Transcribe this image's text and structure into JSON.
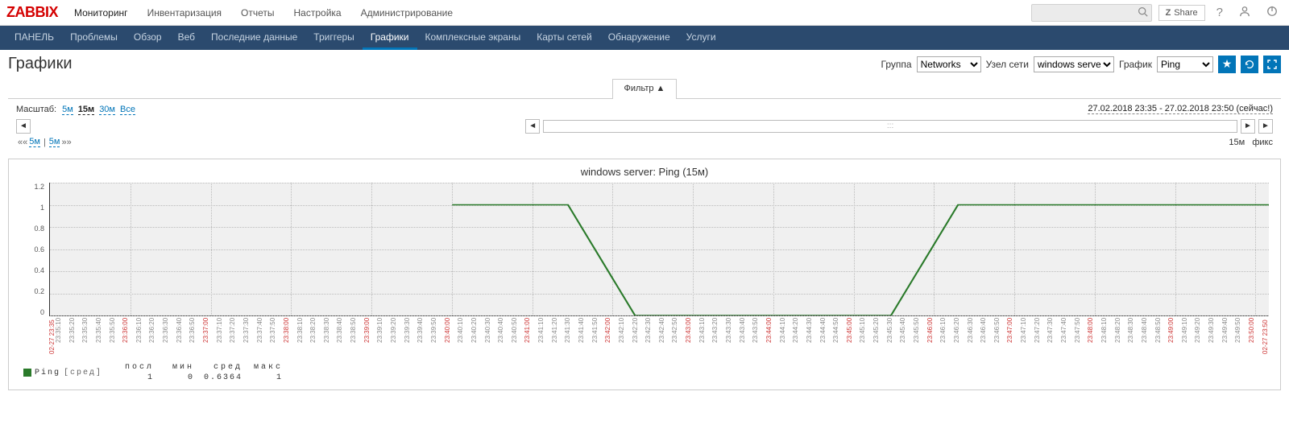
{
  "logo": "ZABBIX",
  "topnav": [
    "Мониторинг",
    "Инвентаризация",
    "Отчеты",
    "Настройка",
    "Администрирование"
  ],
  "topnav_active": 0,
  "search_placeholder": "",
  "share": "Share",
  "subnav": [
    "ПАНЕЛЬ",
    "Проблемы",
    "Обзор",
    "Веб",
    "Последние данные",
    "Триггеры",
    "Графики",
    "Комплексные экраны",
    "Карты сетей",
    "Обнаружение",
    "Услуги"
  ],
  "subnav_active": 6,
  "page_title": "Графики",
  "filters": {
    "group_label": "Группа",
    "group_value": "Networks",
    "host_label": "Узел сети",
    "host_value": "windows server",
    "graph_label": "График",
    "graph_value": "Ping"
  },
  "filter_tab": "Фильтр ▲",
  "scale": {
    "label": "Масштаб:",
    "options": [
      "5м",
      "15м",
      "30м",
      "Все"
    ],
    "selected": 1
  },
  "range_text": "27.02.2018 23:35 - 27.02.2018 23:50 (сейчас!)",
  "slider_handle": ":::",
  "quicknav": {
    "left_arrows": "««",
    "opt_a": "5м",
    "pipe": "|",
    "opt_b": "5м",
    "right_arrows": "»»",
    "info": "15м",
    "fix": "фикс"
  },
  "chart_data": {
    "type": "line",
    "title": "windows server: Ping (15м)",
    "ylabel": "",
    "ylim": [
      0,
      1.2
    ],
    "y_ticks": [
      1.2,
      1.0,
      0.8,
      0.6,
      0.4,
      0.2,
      0
    ],
    "x_start_label": "02-27 23:35",
    "x_end_label": "02-27 23:50",
    "x_ticks": [
      "23:35:10",
      "23:35:20",
      "23:35:30",
      "23:35:40",
      "23:35:50",
      "23:36:00",
      "23:36:10",
      "23:36:20",
      "23:36:30",
      "23:36:40",
      "23:36:50",
      "23:37:00",
      "23:37:10",
      "23:37:20",
      "23:37:30",
      "23:37:40",
      "23:37:50",
      "23:38:00",
      "23:38:10",
      "23:38:20",
      "23:38:30",
      "23:38:40",
      "23:38:50",
      "23:39:00",
      "23:39:10",
      "23:39:20",
      "23:39:30",
      "23:39:40",
      "23:39:50",
      "23:40:00",
      "23:40:10",
      "23:40:20",
      "23:40:30",
      "23:40:40",
      "23:40:50",
      "23:41:00",
      "23:41:10",
      "23:41:20",
      "23:41:30",
      "23:41:40",
      "23:41:50",
      "23:42:00",
      "23:42:10",
      "23:42:20",
      "23:42:30",
      "23:42:40",
      "23:42:50",
      "23:43:00",
      "23:43:10",
      "23:43:20",
      "23:43:30",
      "23:43:40",
      "23:43:50",
      "23:44:00",
      "23:44:10",
      "23:44:20",
      "23:44:30",
      "23:44:40",
      "23:44:50",
      "23:45:00",
      "23:45:10",
      "23:45:20",
      "23:45:30",
      "23:45:40",
      "23:45:50",
      "23:46:00",
      "23:46:10",
      "23:46:20",
      "23:46:30",
      "23:46:40",
      "23:46:50",
      "23:47:00",
      "23:47:10",
      "23:47:20",
      "23:47:30",
      "23:47:40",
      "23:47:50",
      "23:48:00",
      "23:48:10",
      "23:48:20",
      "23:48:30",
      "23:48:40",
      "23:48:50",
      "23:49:00",
      "23:49:10",
      "23:49:20",
      "23:49:30",
      "23:49:40",
      "23:49:50",
      "23:50:00"
    ],
    "x_major_idx": [
      5,
      11,
      17,
      23,
      29,
      35,
      41,
      47,
      53,
      59,
      65,
      71,
      77,
      83,
      89
    ],
    "series": [
      {
        "name": "Ping",
        "color": "#2a7a2a",
        "x_pct": [
          33.0,
          42.5,
          48.0,
          69.0,
          74.5,
          100.0
        ],
        "y_val": [
          1.0,
          1.0,
          0.0,
          0.0,
          1.0,
          1.0
        ]
      }
    ],
    "legend": {
      "name": "Ping",
      "mode": "[сред]",
      "cols": [
        "посл",
        "мин",
        "сред",
        "макс"
      ],
      "vals": [
        "1",
        "0",
        "0.6364",
        "1"
      ]
    }
  }
}
